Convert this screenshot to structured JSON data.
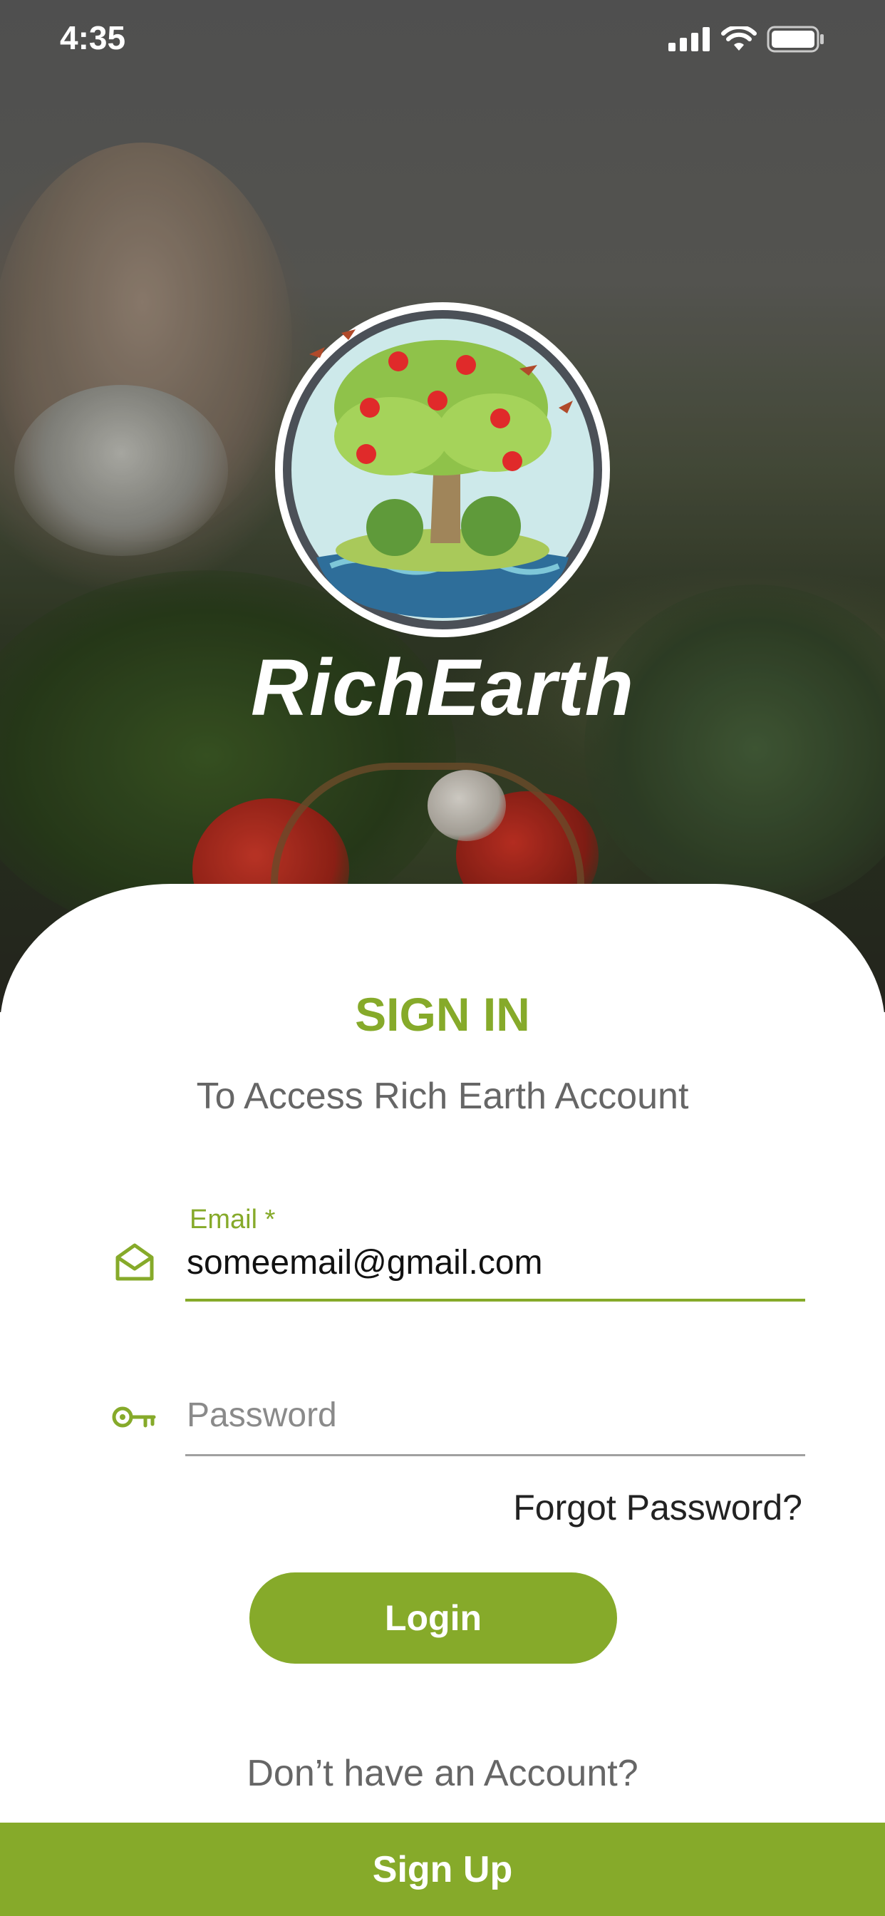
{
  "status_bar": {
    "time": "4:35",
    "icons": [
      "cellular-signal-icon",
      "wifi-icon",
      "battery-icon"
    ]
  },
  "brand": {
    "name": "RichEarth",
    "logo_icon": "apple-tree-logo-icon"
  },
  "signin": {
    "heading": "SIGN IN",
    "subheading": "To Access Rich Earth Account",
    "email_label": "Email *",
    "email_value": "someemail@gmail.com",
    "email_icon": "envelope-open-icon",
    "password_placeholder": "Password",
    "password_value": "",
    "password_icon": "key-icon",
    "forgot_password": "Forgot Password?",
    "login_label": "Login",
    "no_account_text": "Don’t have an Account?",
    "signup_label": "Sign Up"
  },
  "colors": {
    "accent": "#86aa2a",
    "text_muted": "#666666",
    "sheet": "#ffffff"
  }
}
